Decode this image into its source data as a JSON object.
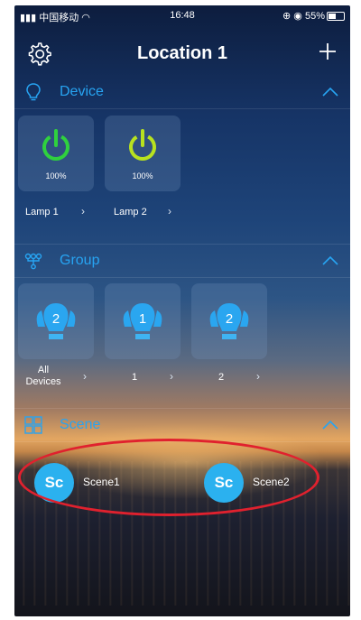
{
  "status_bar": {
    "carrier": "中国移动",
    "time": "16:48",
    "battery": "55%",
    "battery_level": 0.55
  },
  "header": {
    "title": "Location 1",
    "settings_icon": "gear-icon",
    "add_icon": "plus-icon"
  },
  "sections": {
    "device": {
      "title": "Device",
      "icon": "lightbulb-outline-icon",
      "items": [
        {
          "label": "Lamp 1",
          "level": "100%",
          "power_color": "#2fd13e"
        },
        {
          "label": "Lamp 2",
          "level": "100%",
          "power_color": "#b8e21f"
        }
      ]
    },
    "group": {
      "title": "Group",
      "icon": "group-network-icon",
      "items": [
        {
          "label": "All Devices",
          "count": "2"
        },
        {
          "label": "1",
          "count": "1"
        },
        {
          "label": "2",
          "count": "2"
        }
      ]
    },
    "scene": {
      "title": "Scene",
      "icon": "scene-grid-icon",
      "items": [
        {
          "badge": "Sc",
          "label": "Scene1"
        },
        {
          "badge": "Sc",
          "label": "Scene2"
        }
      ]
    }
  },
  "colors": {
    "accent": "#27a4f2",
    "annotation_circle": "#e0212e"
  }
}
